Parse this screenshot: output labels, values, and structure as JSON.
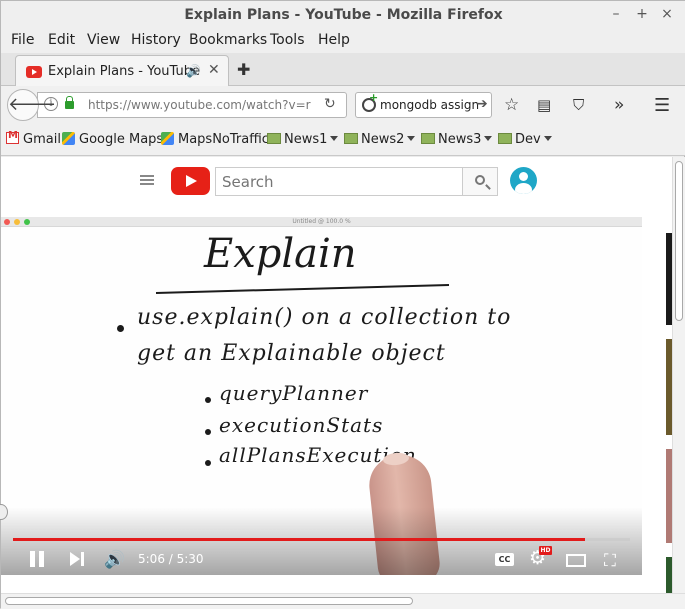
{
  "window": {
    "title": "Explain Plans - YouTube - Mozilla Firefox",
    "controls": {
      "minimize": "–",
      "maximize": "+",
      "close": "×"
    }
  },
  "menubar": {
    "items": [
      {
        "label": "File",
        "key": "F"
      },
      {
        "label": "Edit",
        "key": "E"
      },
      {
        "label": "View",
        "key": "V"
      },
      {
        "label": "History",
        "key": "H"
      },
      {
        "label": "Bookmarks",
        "key": "B"
      },
      {
        "label": "Tools",
        "key": "T"
      },
      {
        "label": "Help",
        "key": "H"
      }
    ]
  },
  "tabs": [
    {
      "label": "Explain Plans - YouTube",
      "icon": "youtube-favicon",
      "audio_icon": "speaker-icon",
      "active": true
    }
  ],
  "navbar": {
    "url": "https://www.youtube.com/watch?v=r",
    "search_query": "mongodb assign",
    "icons": [
      "back-icon",
      "info-icon",
      "lock-icon",
      "reload-icon",
      "search-go-icon",
      "bookmark-star-icon",
      "reading-list-icon",
      "pocket-icon",
      "overflow-icon",
      "hamburger-menu-icon"
    ]
  },
  "bookmarks": [
    {
      "label": "Gmail",
      "icon": "gmail-icon",
      "folder": false
    },
    {
      "label": "Google Maps",
      "icon": "maps-icon",
      "folder": false
    },
    {
      "label": "MapsNoTraffic",
      "icon": "maps-icon",
      "folder": false
    },
    {
      "label": "News1",
      "icon": "folder-icon",
      "folder": true
    },
    {
      "label": "News2",
      "icon": "folder-icon",
      "folder": true
    },
    {
      "label": "News3",
      "icon": "folder-icon",
      "folder": true
    },
    {
      "label": "Dev",
      "icon": "folder-icon",
      "folder": true
    }
  ],
  "youtube": {
    "search_placeholder": "Search",
    "colors": {
      "brand_red": "#e62117",
      "progress_red": "#e21b1b"
    }
  },
  "video": {
    "window_title": "Untitled @ 100.0 %",
    "whiteboard": {
      "heading": "Explain",
      "bullet_main_line1": "use.explain() on a collection to",
      "bullet_main_line2": "get an Explainable object",
      "sub_bullets": [
        "queryPlanner",
        "executionStats",
        "allPlansExecution"
      ]
    },
    "time_current": "5:06",
    "time_total": "5:30",
    "time_display": "5:06 / 5:30",
    "progress_fraction": 0.927,
    "cc_label": "CC",
    "hd_badge": "HD"
  }
}
